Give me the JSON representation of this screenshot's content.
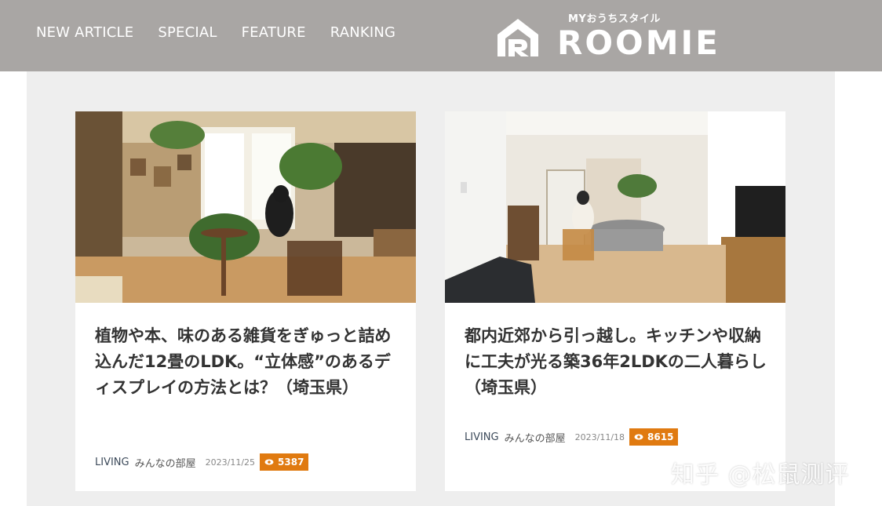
{
  "nav": {
    "items": [
      {
        "label": "NEW ARTICLE"
      },
      {
        "label": "SPECIAL"
      },
      {
        "label": "FEATURE"
      },
      {
        "label": "RANKING"
      }
    ]
  },
  "brand": {
    "tagline": "MYおうちスタイル",
    "name": "ROOMIE"
  },
  "articles": [
    {
      "title": "植物や本、味のある雑貨をぎゅっと詰め込んだ12畳のLDK。“立体感”のあるディスプレイの方法とは？（埼玉県）",
      "category": "LIVING",
      "subcategory": "みんなの部屋",
      "date": "2023/11/25",
      "views": "5387",
      "image": "living-room-plants-photo"
    },
    {
      "title": "都内近郊から引っ越し。キッチンや収納に工夫が光る築36年2LDKの二人暮らし（埼玉県）",
      "category": "LIVING",
      "subcategory": "みんなの部屋",
      "date": "2023/11/18",
      "views": "8615",
      "image": "dining-room-photo"
    }
  ],
  "watermark": "知乎 @松鼠测评",
  "colors": {
    "header_bg": "#a9a6a4",
    "content_bg": "#eeeeee",
    "badge": "#e07a10",
    "category": "#3c4a5a"
  }
}
